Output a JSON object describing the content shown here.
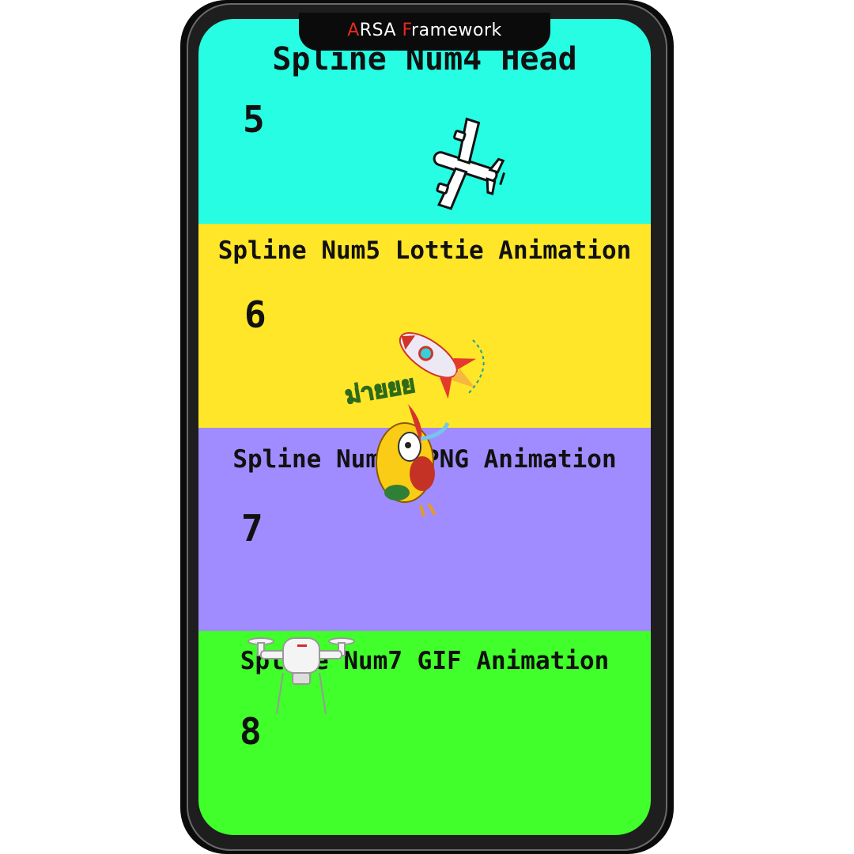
{
  "header": {
    "title_first_letter": "A",
    "title_part1": "RSA ",
    "title_second_letter": "F",
    "title_part2": "ramework"
  },
  "bands": [
    {
      "title": "Spline Num4 Head",
      "number": "5",
      "color": "#26fde3"
    },
    {
      "title": "Spline Num5 Lottie Animation",
      "number": "6",
      "color": "#ffe628"
    },
    {
      "title": "Spline Num6 APNG Animation",
      "number": "7",
      "color": "#a08cff"
    },
    {
      "title": "Spline Num7 GIF Animation",
      "number": "8",
      "color": "#41ff2a"
    }
  ],
  "sprites": {
    "plane": "airplane-icon",
    "rocket": "rocket-icon",
    "bird": "bird-character-icon",
    "drone": "drone-icon",
    "thai_text": "ม่ายยย"
  },
  "colors": {
    "accent": "#e52b1f"
  }
}
